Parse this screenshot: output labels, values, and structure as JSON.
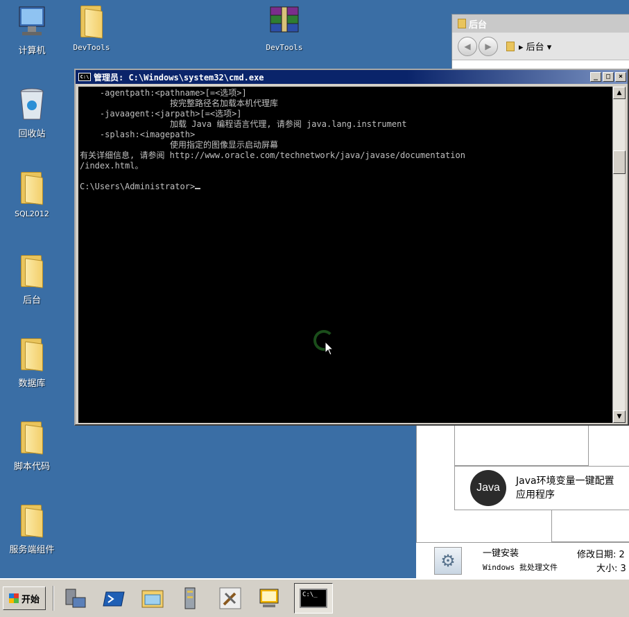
{
  "desktop": {
    "icons": [
      {
        "label": "计算机",
        "icon": "computer-icon"
      },
      {
        "label": "DevTools",
        "icon": "folder-icon"
      },
      {
        "label": "DevTools",
        "icon": "winrar-archive-icon"
      },
      {
        "label": "回收站",
        "icon": "recycle-bin-icon"
      },
      {
        "label": "SQL2012",
        "icon": "folder-icon"
      },
      {
        "label": "后台",
        "icon": "folder-icon"
      },
      {
        "label": "数据库",
        "icon": "folder-icon"
      },
      {
        "label": "脚本代码",
        "icon": "folder-icon"
      },
      {
        "label": "服务端组件",
        "icon": "folder-icon"
      }
    ]
  },
  "explorer": {
    "title": "后台",
    "address": "▸ 后台 ▾",
    "java_card": {
      "logo": "Java",
      "title": "Java环境变量一键配置",
      "subtitle": "应用程序"
    },
    "file": {
      "name": "一键安装",
      "type": "Windows 批处理文件",
      "modified_label": "修改日期: 2",
      "size_label": "大小: 3"
    }
  },
  "cmd": {
    "title": "管理员: C:\\Windows\\system32\\cmd.exe",
    "lines": [
      "    -agentpath:<pathname>[=<选项>]",
      "                  按完整路径名加载本机代理库",
      "    -javaagent:<jarpath>[=<选项>]",
      "                  加载 Java 编程语言代理, 请参阅 java.lang.instrument",
      "    -splash:<imagepath>",
      "                  使用指定的图像显示启动屏幕",
      "有关详细信息, 请参阅 http://www.oracle.com/technetwork/java/javase/documentation",
      "/index.html。",
      "",
      "C:\\Users\\Administrator>"
    ],
    "buttons": {
      "minimize": "_",
      "maximize": "□",
      "close": "×"
    }
  },
  "taskbar": {
    "start_label": "开始",
    "items": [
      "server-manager-icon",
      "powershell-icon",
      "explorer-icon",
      "file-cabinet-icon",
      "tools-icon",
      "monitor-icon",
      "cmd-icon"
    ],
    "cmd_icon_text": "C:\\_"
  }
}
